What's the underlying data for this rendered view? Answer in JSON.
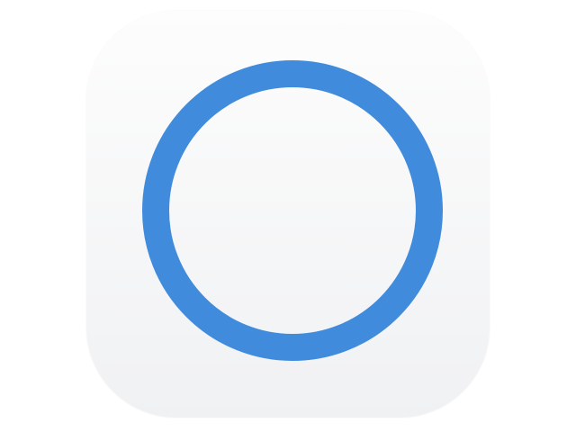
{
  "app_icon": {
    "icon": "circle-ring-icon",
    "colors": {
      "ring": "#418bdd",
      "background_top": "#fdfdfd",
      "background_bottom": "#f0f1f3"
    }
  }
}
